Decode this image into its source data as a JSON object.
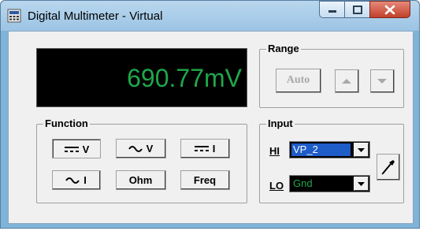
{
  "window": {
    "title": "Digital Multimeter - Virtual"
  },
  "display": {
    "reading": "690.77mV",
    "color": "#1fa84a"
  },
  "range": {
    "label": "Range",
    "auto_label": "Auto"
  },
  "function": {
    "label": "Function",
    "buttons": {
      "dc_voltage": "V",
      "ac_voltage": "V",
      "dc_current": "I",
      "ac_current": "I",
      "ohm": "Ohm",
      "freq": "Freq"
    },
    "selected": "dc_voltage"
  },
  "input": {
    "label": "Input",
    "hi_label": "HI",
    "hi_value": "VP_2",
    "lo_label": "LO",
    "lo_value": "Gnd"
  },
  "colors": {
    "hi_select_bg": "#1e5cc8",
    "lo_text": "#1fa84a",
    "close_button": "#c2402a"
  },
  "icons": [
    "app-icon",
    "minimize-icon",
    "maximize-icon",
    "close-icon",
    "dc-symbol-icon",
    "ac-symbol-icon",
    "arrow-up-icon",
    "arrow-down-icon",
    "dropdown-arrow-icon",
    "probe-icon"
  ]
}
